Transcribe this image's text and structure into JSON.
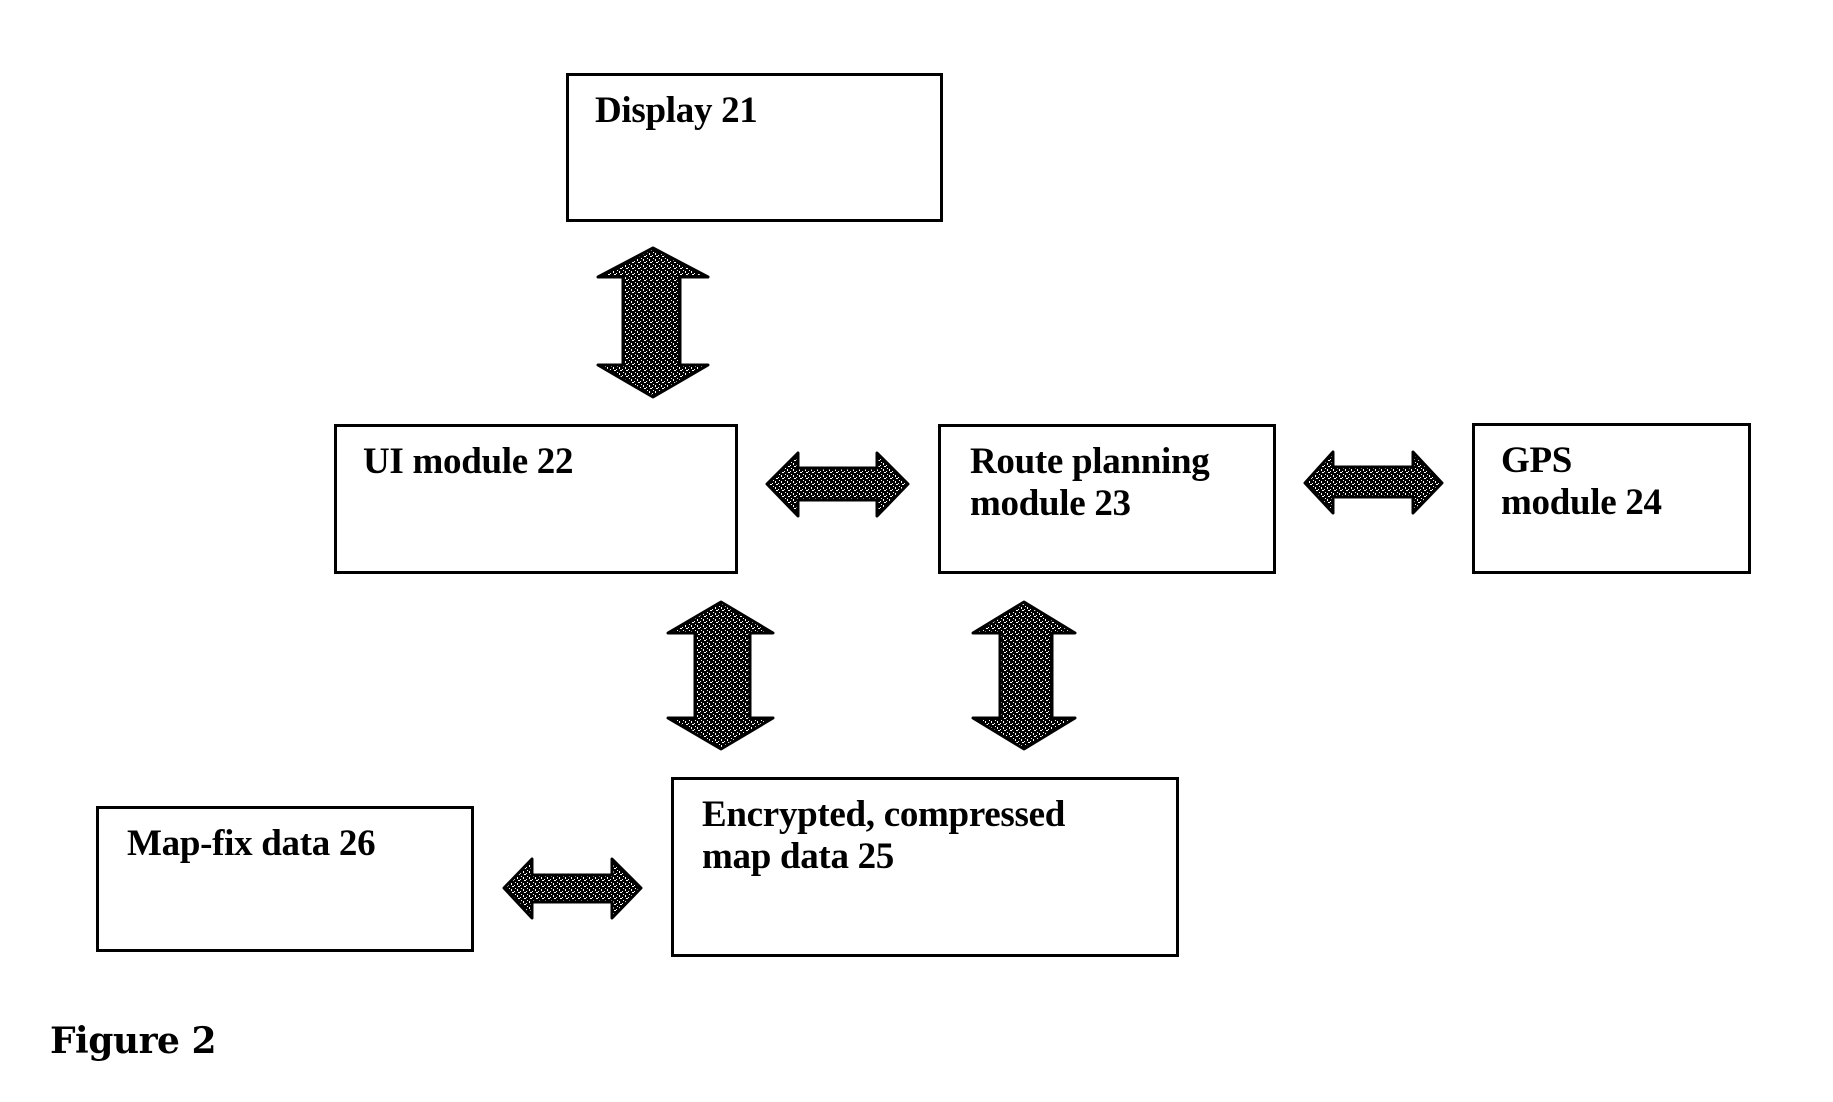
{
  "figure": {
    "caption": "Figure 2"
  },
  "blocks": {
    "display": {
      "label": "Display 21"
    },
    "ui_module": {
      "label": "UI module 22"
    },
    "route_planning": {
      "label": "Route planning\nmodule 23"
    },
    "gps_module": {
      "label": "GPS\nmodule 24"
    },
    "map_data": {
      "label": "Encrypted, compressed\nmap data 25"
    },
    "map_fix": {
      "label": "Map-fix data 26"
    }
  },
  "connections": [
    {
      "from": "Display 21",
      "to": "UI module 22",
      "direction": "bidirectional"
    },
    {
      "from": "UI module 22",
      "to": "Route planning module 23",
      "direction": "bidirectional"
    },
    {
      "from": "Route planning module 23",
      "to": "GPS module 24",
      "direction": "bidirectional"
    },
    {
      "from": "UI module 22",
      "to": "Encrypted, compressed map data 25",
      "direction": "bidirectional"
    },
    {
      "from": "Route planning module 23",
      "to": "Encrypted, compressed map data 25",
      "direction": "bidirectional"
    },
    {
      "from": "Map-fix data 26",
      "to": "Encrypted, compressed map data 25",
      "direction": "bidirectional"
    }
  ],
  "colors": {
    "stroke": "#000000",
    "background": "#ffffff",
    "arrow_fill_light": "#ffffff",
    "arrow_fill_dark": "#000000"
  }
}
